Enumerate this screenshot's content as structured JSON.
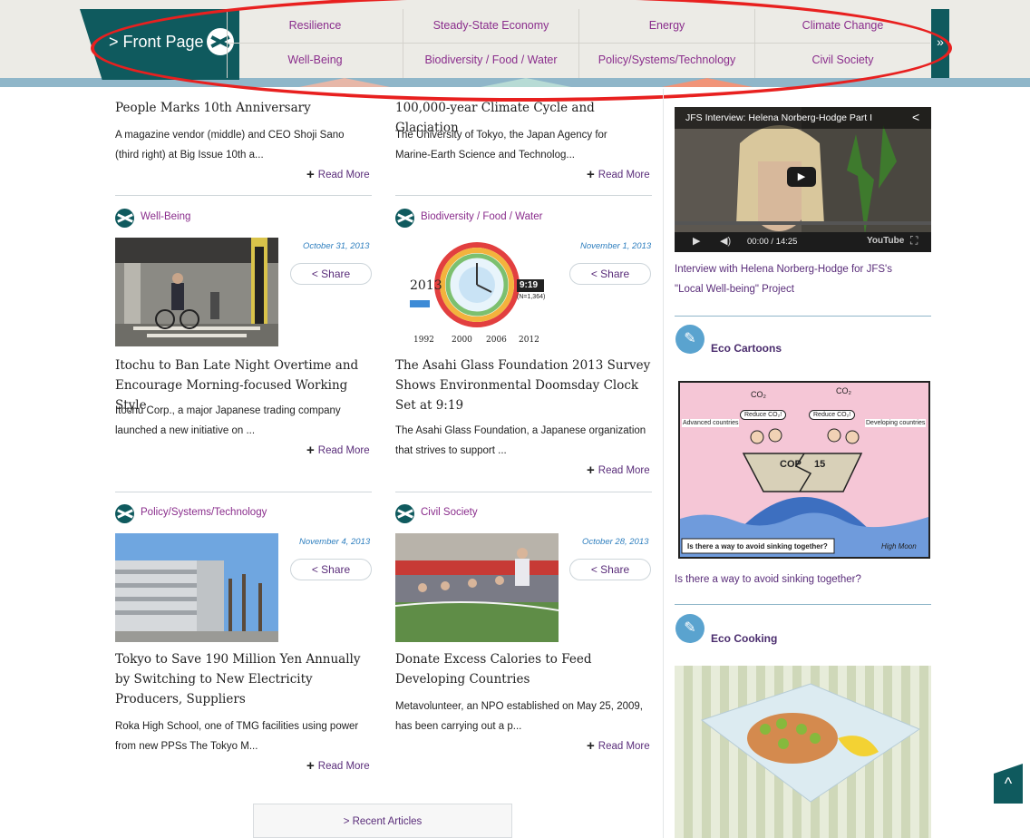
{
  "nav": {
    "front_page": "> Front Page",
    "more_glyph": "»",
    "topics_row1": [
      "Resilience",
      "Steady-State Economy",
      "Energy",
      "Climate Change"
    ],
    "topics_row2": [
      "Well-Being",
      "Biodiversity / Food / Water",
      "Policy/Systems/Technology",
      "Civil Society"
    ]
  },
  "articles": {
    "top_left": {
      "headline": "People Marks 10th Anniversary",
      "excerpt": "A magazine vendor (middle) and CEO Shoji Sano (third right) at Big Issue 10th a...",
      "read_more": "Read More"
    },
    "top_right": {
      "headline": "100,000-year Climate Cycle and Glaciation",
      "excerpt": "The University of Tokyo, the Japan Agency for Marine-Earth Science and Technolog...",
      "read_more": "Read More"
    },
    "wellbeing": {
      "category": "Well-Being",
      "date": "October 31, 2013",
      "share": "Share",
      "headline": "Itochu to Ban Late Night Overtime and Encourage Morning-focused Working Style",
      "excerpt": "Itochu Corp., a major Japanese trading company launched a new initiative on ...",
      "read_more": "Read More"
    },
    "biodiversity": {
      "category": "Biodiversity / Food / Water",
      "date": "November 1, 2013",
      "share": "Share",
      "headline": "The Asahi Glass Foundation 2013 Survey Shows Environmental Doomsday Clock Set at 9:19",
      "excerpt": "The Asahi Glass Foundation, a Japanese organization that strives to support ...",
      "read_more": "Read More",
      "figure": {
        "year": "2013",
        "time": "9:19",
        "sample": "(N=1,364)",
        "years_axis": [
          "1992",
          "2000",
          "2006",
          "2012"
        ]
      }
    },
    "policy": {
      "category": "Policy/Systems/Technology",
      "date": "November 4, 2013",
      "share": "Share",
      "headline": "Tokyo to Save 190 Million Yen Annually by Switching to New Electricity Producers, Suppliers",
      "excerpt": "Roka High School, one of TMG facilities using power from new PPSs The Tokyo M...",
      "read_more": "Read More"
    },
    "civil": {
      "category": "Civil Society",
      "date": "October 28, 2013",
      "share": "Share",
      "headline": "Donate Excess Calories to Feed Developing Countries",
      "excerpt": "Metavolunteer, an NPO established on May 25, 2009, has been carrying out a p...",
      "read_more": "Read More"
    }
  },
  "recent_articles": "> Recent Articles",
  "sidebar": {
    "video": {
      "title": "JFS Interview: Helena Norberg-Hodge Part I",
      "time": "00:00 / 14:25",
      "brand": "YouTube",
      "caption": "Interview with Helena Norberg-Hodge for JFS's \"Local Well-being\" Project"
    },
    "eco_cartoons": {
      "title": "Eco Cartoons",
      "cartoon": {
        "co2_left": "CO₂",
        "co2_right": "CO₂",
        "label_left": "Advanced countries",
        "bubble_left": "Reduce CO₂!",
        "bubble_right": "Reduce CO₂!",
        "label_right": "Developing countries",
        "boat_left": "COP",
        "boat_right": "15",
        "caption_box": "Is there a way to avoid sinking together?",
        "signature": "High Moon"
      },
      "caption": "Is there a way to avoid sinking together?"
    },
    "eco_cooking": {
      "title": "Eco Cooking"
    }
  },
  "colors": {
    "teal": "#0f5a5e",
    "purple_link": "#8a2d8c",
    "date_blue": "#2f7fbf",
    "highlight_red": "#e8201f",
    "sidebar_badge": "#5aa3cf"
  }
}
